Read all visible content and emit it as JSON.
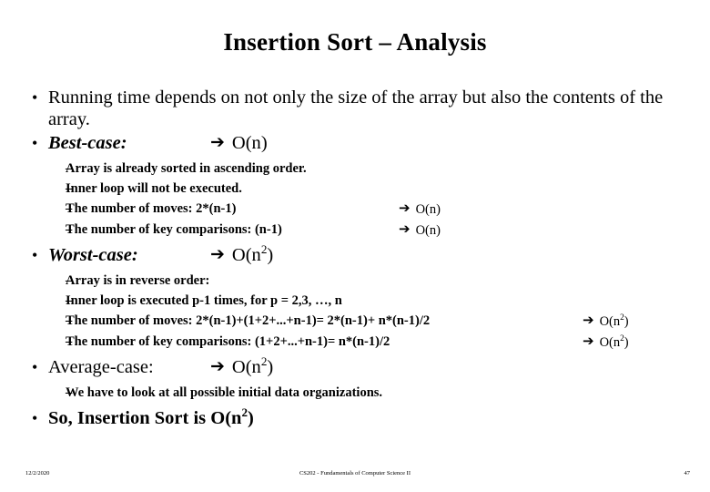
{
  "slide": {
    "title": "Insertion Sort – Analysis",
    "bullets": {
      "intro": "Running time depends on not only the size of the array but also the contents of the array.",
      "best_case": {
        "label": "Best-case:",
        "arrow": "➔",
        "complexity_prefix": "O(n",
        "complexity_suffix": ")",
        "complexity_exponent": "",
        "items": [
          {
            "text": "Array is already sorted in ascending order.",
            "arrow": "",
            "complexity": ""
          },
          {
            "text": "Inner loop will not be executed.",
            "arrow": "",
            "complexity": ""
          },
          {
            "text": "The number of moves: 2*(n-1)",
            "arrow": "➔",
            "complexity": "O(n)"
          },
          {
            "text": "The number of key comparisons: (n-1)",
            "arrow": "➔",
            "complexity": "O(n)"
          }
        ]
      },
      "worst_case": {
        "label": "Worst-case:",
        "arrow": "➔",
        "complexity_prefix": "O(n",
        "complexity_exponent": "2",
        "complexity_suffix": ")",
        "items": [
          {
            "text": "Array is in reverse order:",
            "arrow": "",
            "complexity_base": "",
            "complexity_exp": "",
            "complexity_end": ""
          },
          {
            "text": "Inner loop is executed p-1 times, for p = 2,3, …, n",
            "arrow": "",
            "complexity_base": "",
            "complexity_exp": "",
            "complexity_end": ""
          },
          {
            "text": "The number of moves: 2*(n-1)+(1+2+...+n-1)= 2*(n-1)+ n*(n-1)/2",
            "arrow": "➔",
            "complexity_base": "O(n",
            "complexity_exp": "2",
            "complexity_end": ")"
          },
          {
            "text": "The number of key comparisons: (1+2+...+n-1)= n*(n-1)/2",
            "arrow": "➔",
            "complexity_base": "O(n",
            "complexity_exp": "2",
            "complexity_end": ")"
          }
        ]
      },
      "average_case": {
        "label": "Average-case:",
        "arrow": "➔",
        "complexity_prefix": "O(n",
        "complexity_exponent": "2",
        "complexity_suffix": ")",
        "items": [
          {
            "text": "We have to look at all possible initial data organizations."
          }
        ]
      },
      "conclusion": {
        "text_prefix": "So, Insertion Sort is O(n",
        "text_exponent": "2",
        "text_suffix": ")"
      }
    },
    "bullet_glyph": "•",
    "dash_glyph": "–"
  },
  "footer": {
    "date": "12/2/2020",
    "course": "CS202 - Fundamentals of Computer Science II",
    "page": "47"
  }
}
